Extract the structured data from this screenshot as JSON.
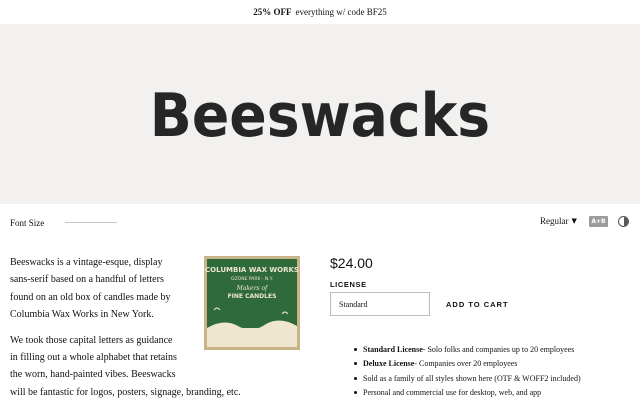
{
  "promo": {
    "bold": "25% OFF",
    "text": "everything w/ code BF25"
  },
  "hero": {
    "title": "Beeswacks"
  },
  "controls": {
    "font_size_label": "Font Size",
    "style_value": "Regular",
    "ab_label": "A+B",
    "chevron_icon": "chevron-down-icon",
    "contrast_icon": "contrast-icon"
  },
  "description": {
    "p1": "Beeswacks is a vintage-esque, display\nsans-serif based on a handful of letters\nfound on an old box of candles made by\nColumbia Wax Works in New York.",
    "p2": "We took those capital letters as guidance\nin filling out a whole alphabet that retains\nthe worn, hand-painted vibes. Beeswacks\nwill be fantastic for logos, posters, signage, branding, etc."
  },
  "product_image": {
    "line1": "COLUMBIA WAX WORKS",
    "line2": "OZONE PARK - N.Y.",
    "line3": "Makers of",
    "line4": "FINE CANDLES",
    "colors": {
      "green": "#2f6b3a",
      "cream": "#efe6cf",
      "tan": "#c9b48a"
    }
  },
  "purchase": {
    "price": "$24.00",
    "license_label": "LICENSE",
    "license_value": "Standard",
    "add_to_cart": "ADD TO CART"
  },
  "features": [
    {
      "bold": "Standard License",
      "text": " - Solo folks and companies up to 20 employees"
    },
    {
      "bold": "Deluxe License",
      "text": " - Companies over 20 employees"
    },
    {
      "bold": "",
      "text": "Sold as a family of all styles shown here (OTF & WOFF2 included)"
    },
    {
      "bold": "",
      "text": "Personal and commercial use for desktop, web, and app"
    }
  ]
}
